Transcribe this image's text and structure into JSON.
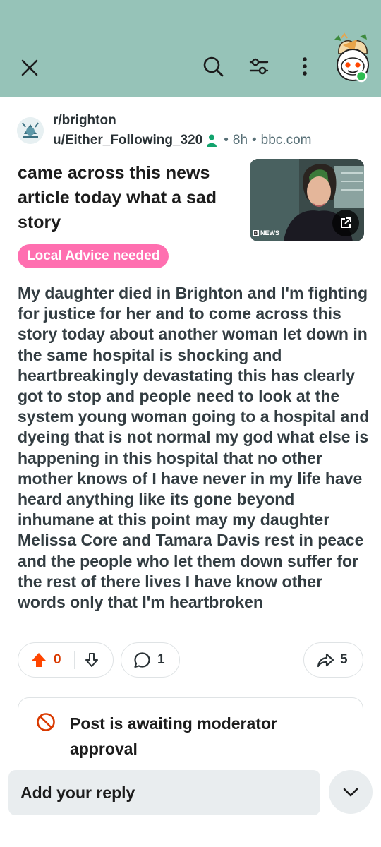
{
  "topbar": {
    "background": "#96c3b8",
    "close_icon": "close-icon",
    "search_icon": "search-icon",
    "filter_icon": "filter-icon",
    "more_icon": "more-vertical-icon"
  },
  "post": {
    "subreddit": "r/brighton",
    "author": "u/Either_Following_320",
    "age": "8h",
    "domain": "bbc.com",
    "title": "came across this news article today what a sad story",
    "thumbnail": {
      "badge": "NEWS",
      "open_icon": "external-link-icon"
    },
    "flair": "Local Advice needed",
    "flair_color": "#ff6fb0",
    "body": "My daughter died in Brighton and I'm fighting for justice for her and to come across this story today about another woman let down in the same hospital is shocking and heartbreakingly devastating this has clearly got to stop and people need to look at the system young woman going to a hospital and dyeing that is not normal my god what else is happening in this hospital that no other mother knows of I have never in my life have heard anything like its gone beyond inhumane at this point may my daughter Melissa Core and Tamara Davis rest in peace and the people who let them down suffer for the rest of there lives I have know other words only that I'm heartbroken"
  },
  "actions": {
    "votes": "0",
    "upvote_color": "#d93900",
    "comments": "1",
    "shares": "5"
  },
  "moderation": {
    "message": "Post is awaiting moderator approval",
    "icon_color": "#d93900"
  },
  "reply": {
    "placeholder": "Add your reply"
  }
}
